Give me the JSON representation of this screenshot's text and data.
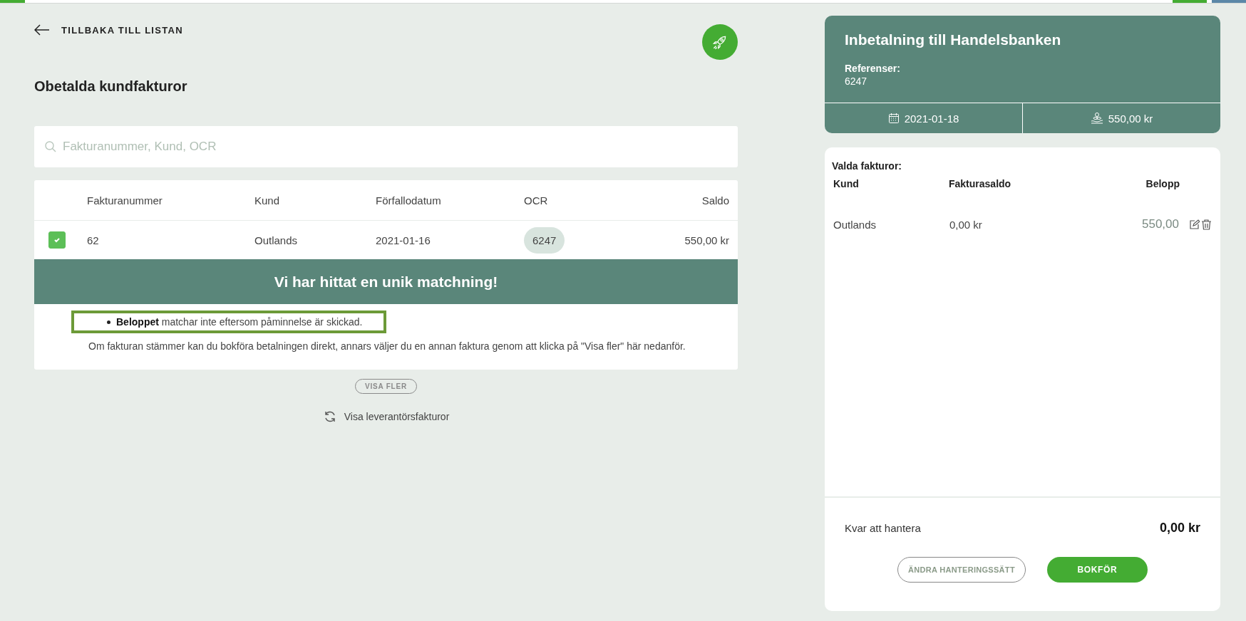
{
  "progress": {
    "level": 0.02
  },
  "back_link": {
    "label": "TILLBAKA TILL LISTAN"
  },
  "heading": "Obetalda kundfakturor",
  "search": {
    "placeholder": "Fakturanummer, Kund, OCR"
  },
  "table": {
    "columns": [
      "Fakturanummer",
      "Kund",
      "Förfallodatum",
      "OCR",
      "Saldo"
    ],
    "rows": [
      {
        "checked": true,
        "invoice": "62",
        "customer": "Outlands",
        "due": "2021-01-16",
        "ocr": "6247",
        "balance": "550,00 kr"
      }
    ]
  },
  "match": {
    "title": "Vi har hittat en unik matchning!",
    "bullets": [
      "**Beloppet** matchar inte eftersom påminnelse är skickad."
    ],
    "note": "Om fakturan stämmer kan du bokföra betalningen direkt, annars väljer du en annan faktura genom att klicka på \"Visa fler\" här nedanför."
  },
  "show_more": "VISA FLER",
  "toggle_link": "Visa leverantörsfakturor",
  "payment": {
    "title": "Inbetalning till Handelsbanken",
    "ref_label": "Referenser:",
    "ref_value": "6247",
    "date": "2021-01-18",
    "amount": "550,00 kr"
  },
  "selected": {
    "title": "Valda fakturor:",
    "columns": [
      "Kund",
      "Fakturasaldo",
      "Belopp"
    ],
    "rows": [
      {
        "customer": "Outlands",
        "balance": "0,00 kr",
        "amount": "550,00"
      }
    ]
  },
  "remaining": {
    "label": "Kvar att hantera",
    "value": "0,00 kr"
  },
  "buttons": [
    {
      "kind": "secondary",
      "label": "ÄNDRA HANTERINGSSÄTT"
    },
    {
      "kind": "primary",
      "label": "BOKFÖR"
    }
  ]
}
